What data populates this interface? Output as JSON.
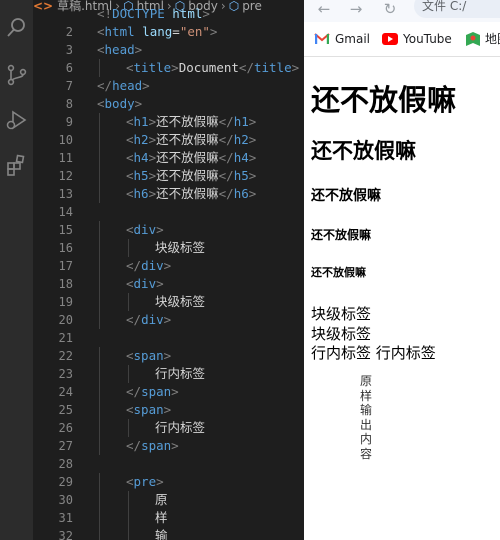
{
  "editor": {
    "breadcrumbs": [
      "草稿.html",
      "html",
      "body",
      "pre"
    ],
    "lines": [
      {
        "n": "",
        "indent": 0,
        "parts": [
          [
            "brk",
            "<!"
          ],
          [
            "tag",
            "DOCTYPE"
          ],
          [
            "attr",
            " html"
          ],
          [
            "brk",
            ">"
          ]
        ]
      },
      {
        "n": "2",
        "indent": 0,
        "parts": [
          [
            "brk",
            "<"
          ],
          [
            "tag",
            "html"
          ],
          [
            "attr",
            " lang"
          ],
          [
            "txt",
            "="
          ],
          [
            "str",
            "\"en\""
          ],
          [
            "brk",
            ">"
          ]
        ]
      },
      {
        "n": "3",
        "indent": 0,
        "parts": [
          [
            "brk",
            "<"
          ],
          [
            "tag",
            "head"
          ],
          [
            "brk",
            ">"
          ]
        ]
      },
      {
        "n": "6",
        "indent": 1,
        "parts": [
          [
            "brk",
            "<"
          ],
          [
            "tag",
            "title"
          ],
          [
            "brk",
            ">"
          ],
          [
            "txt",
            "Document"
          ],
          [
            "brk",
            "</"
          ],
          [
            "tag",
            "title"
          ],
          [
            "brk",
            ">"
          ]
        ]
      },
      {
        "n": "7",
        "indent": 0,
        "parts": [
          [
            "brk",
            "</"
          ],
          [
            "tag",
            "head"
          ],
          [
            "brk",
            ">"
          ]
        ]
      },
      {
        "n": "8",
        "indent": 0,
        "parts": [
          [
            "brk",
            "<"
          ],
          [
            "tag",
            "body"
          ],
          [
            "brk",
            ">"
          ]
        ]
      },
      {
        "n": "9",
        "indent": 1,
        "parts": [
          [
            "brk",
            "<"
          ],
          [
            "tag",
            "h1"
          ],
          [
            "brk",
            ">"
          ],
          [
            "txt",
            "还不放假嘛"
          ],
          [
            "brk",
            "</"
          ],
          [
            "tag",
            "h1"
          ],
          [
            "brk",
            ">"
          ]
        ]
      },
      {
        "n": "10",
        "indent": 1,
        "parts": [
          [
            "brk",
            "<"
          ],
          [
            "tag",
            "h2"
          ],
          [
            "brk",
            ">"
          ],
          [
            "txt",
            "还不放假嘛"
          ],
          [
            "brk",
            "</"
          ],
          [
            "tag",
            "h2"
          ],
          [
            "brk",
            ">"
          ]
        ]
      },
      {
        "n": "11",
        "indent": 1,
        "parts": [
          [
            "brk",
            "<"
          ],
          [
            "tag",
            "h4"
          ],
          [
            "brk",
            ">"
          ],
          [
            "txt",
            "还不放假嘛"
          ],
          [
            "brk",
            "</"
          ],
          [
            "tag",
            "h4"
          ],
          [
            "brk",
            ">"
          ]
        ]
      },
      {
        "n": "12",
        "indent": 1,
        "parts": [
          [
            "brk",
            "<"
          ],
          [
            "tag",
            "h5"
          ],
          [
            "brk",
            ">"
          ],
          [
            "txt",
            "还不放假嘛"
          ],
          [
            "brk",
            "</"
          ],
          [
            "tag",
            "h5"
          ],
          [
            "brk",
            ">"
          ]
        ]
      },
      {
        "n": "13",
        "indent": 1,
        "parts": [
          [
            "brk",
            "<"
          ],
          [
            "tag",
            "h6"
          ],
          [
            "brk",
            ">"
          ],
          [
            "txt",
            "还不放假嘛"
          ],
          [
            "brk",
            "</"
          ],
          [
            "tag",
            "h6"
          ],
          [
            "brk",
            ">"
          ]
        ]
      },
      {
        "n": "14",
        "indent": 0,
        "parts": []
      },
      {
        "n": "15",
        "indent": 1,
        "parts": [
          [
            "brk",
            "<"
          ],
          [
            "tag",
            "div"
          ],
          [
            "brk",
            ">"
          ]
        ]
      },
      {
        "n": "16",
        "indent": 2,
        "parts": [
          [
            "txt",
            "块级标签"
          ]
        ]
      },
      {
        "n": "17",
        "indent": 1,
        "parts": [
          [
            "brk",
            "</"
          ],
          [
            "tag",
            "div"
          ],
          [
            "brk",
            ">"
          ]
        ]
      },
      {
        "n": "18",
        "indent": 1,
        "parts": [
          [
            "brk",
            "<"
          ],
          [
            "tag",
            "div"
          ],
          [
            "brk",
            ">"
          ]
        ]
      },
      {
        "n": "19",
        "indent": 2,
        "parts": [
          [
            "txt",
            "块级标签"
          ]
        ]
      },
      {
        "n": "20",
        "indent": 1,
        "parts": [
          [
            "brk",
            "</"
          ],
          [
            "tag",
            "div"
          ],
          [
            "brk",
            ">"
          ]
        ]
      },
      {
        "n": "21",
        "indent": 0,
        "parts": []
      },
      {
        "n": "22",
        "indent": 1,
        "parts": [
          [
            "brk",
            "<"
          ],
          [
            "tag",
            "span"
          ],
          [
            "brk",
            ">"
          ]
        ]
      },
      {
        "n": "23",
        "indent": 2,
        "parts": [
          [
            "txt",
            "行内标签"
          ]
        ]
      },
      {
        "n": "24",
        "indent": 1,
        "parts": [
          [
            "brk",
            "</"
          ],
          [
            "tag",
            "span"
          ],
          [
            "brk",
            ">"
          ]
        ]
      },
      {
        "n": "25",
        "indent": 1,
        "parts": [
          [
            "brk",
            "<"
          ],
          [
            "tag",
            "span"
          ],
          [
            "brk",
            ">"
          ]
        ]
      },
      {
        "n": "26",
        "indent": 2,
        "parts": [
          [
            "txt",
            "行内标签"
          ]
        ]
      },
      {
        "n": "27",
        "indent": 1,
        "parts": [
          [
            "brk",
            "</"
          ],
          [
            "tag",
            "span"
          ],
          [
            "brk",
            ">"
          ]
        ]
      },
      {
        "n": "28",
        "indent": 0,
        "parts": []
      },
      {
        "n": "29",
        "indent": 1,
        "parts": [
          [
            "brk",
            "<"
          ],
          [
            "tag",
            "pre"
          ],
          [
            "brk",
            ">"
          ]
        ]
      },
      {
        "n": "30",
        "indent": 2,
        "parts": [
          [
            "txt",
            "原"
          ]
        ]
      },
      {
        "n": "31",
        "indent": 2,
        "parts": [
          [
            "txt",
            "样"
          ]
        ]
      },
      {
        "n": "32",
        "indent": 2,
        "parts": [
          [
            "txt",
            "输"
          ]
        ]
      }
    ]
  },
  "browser": {
    "address": "文件  C:/",
    "bookmarks": [
      "Gmail",
      "YouTube",
      "地图"
    ],
    "page": {
      "h1": "还不放假嘛",
      "h2": "还不放假嘛",
      "h4": "还不放假嘛",
      "h5": "还不放假嘛",
      "h6": "还不放假嘛",
      "div1": "块级标签",
      "div2": "块级标签",
      "span_line": "行内标签 行内标签",
      "pre_chars": [
        "原",
        "样",
        "输",
        "出",
        "内",
        "容"
      ]
    }
  }
}
